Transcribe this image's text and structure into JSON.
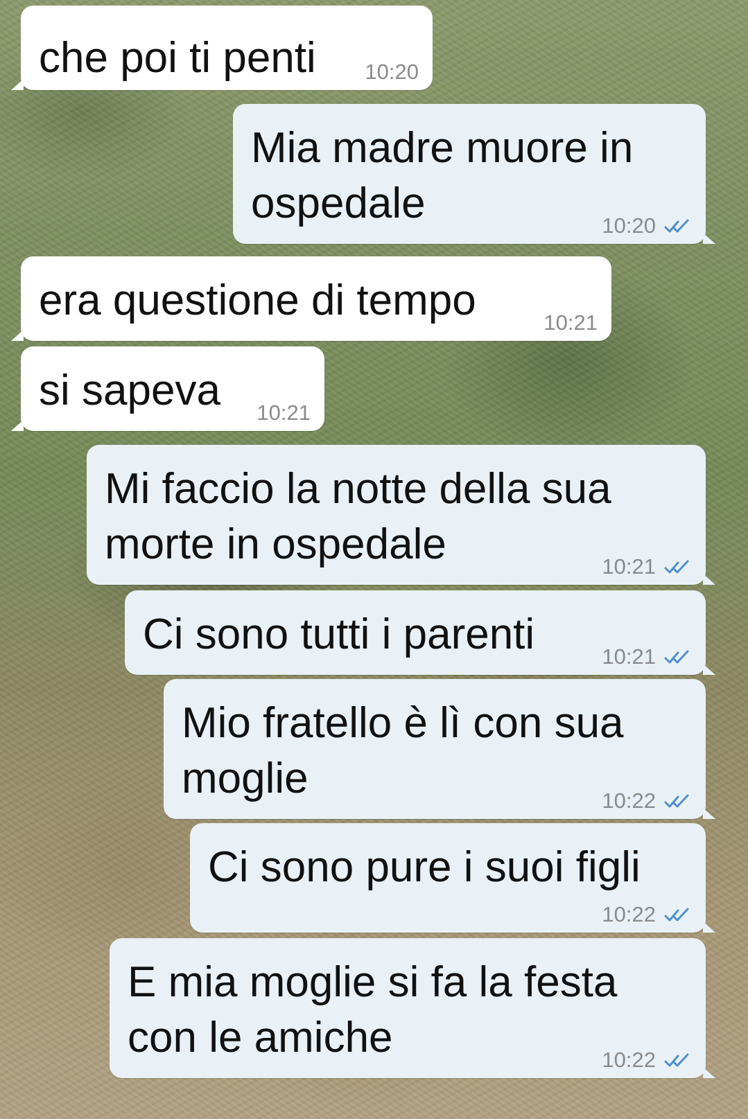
{
  "messages": [
    {
      "text": "che poi ti penti",
      "time": "10:20"
    },
    {
      "text": "Mia madre muore in ospedale",
      "time": "10:20",
      "status_icon": "double-check-icon"
    },
    {
      "text": "era questione di tempo",
      "time": "10:21"
    },
    {
      "text": "si sapeva",
      "time": "10:21"
    },
    {
      "text": "Mi faccio la notte della sua morte in ospedale",
      "time": "10:21",
      "status_icon": "double-check-icon"
    },
    {
      "text": "Ci sono tutti i parenti",
      "time": "10:21",
      "status_icon": "double-check-icon"
    },
    {
      "text": "Mio fratello è lì con sua moglie",
      "time": "10:22",
      "status_icon": "double-check-icon"
    },
    {
      "text": "Ci sono pure i suoi figli",
      "time": "10:22",
      "status_icon": "double-check-icon"
    },
    {
      "text": "E mia moglie si fa la festa con le amiche",
      "time": "10:22",
      "status_icon": "double-check-icon"
    }
  ],
  "colors": {
    "incoming_bubble": "#ffffff",
    "outgoing_bubble": "#e9f1f6",
    "timestamp": "#8a8a8a",
    "read_receipt": "#4f8fcf"
  }
}
